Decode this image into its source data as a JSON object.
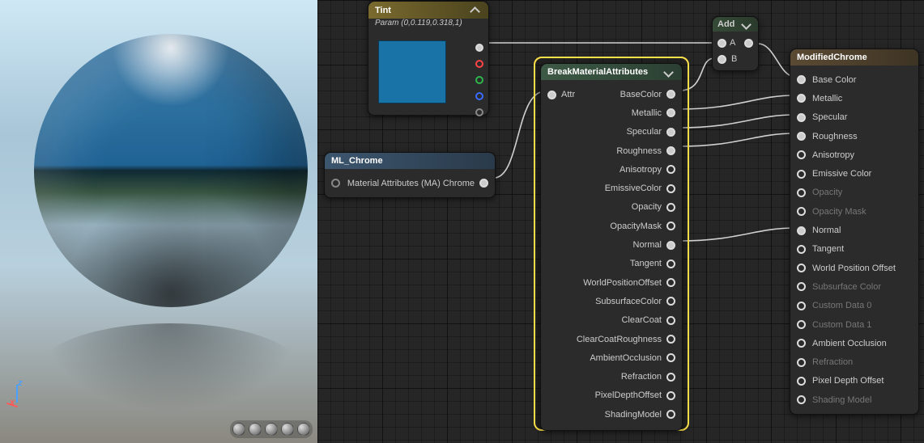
{
  "preview": {
    "axis_z": "z",
    "axis_x": "x"
  },
  "tint": {
    "title": "Tint",
    "subtitle": "Param (0,0.119,0.318,1)",
    "swatch_color": "#1a73a6"
  },
  "ml_chrome": {
    "title": "ML_Chrome",
    "output": "Material Attributes (MA) Chrome"
  },
  "break": {
    "title": "BreakMaterialAttributes",
    "input": "Attr",
    "outputs": [
      "BaseColor",
      "Metallic",
      "Specular",
      "Roughness",
      "Anisotropy",
      "EmissiveColor",
      "Opacity",
      "OpacityMask",
      "Normal",
      "Tangent",
      "WorldPositionOffset",
      "SubsurfaceColor",
      "ClearCoat",
      "ClearCoatRoughness",
      "AmbientOcclusion",
      "Refraction",
      "PixelDepthOffset",
      "ShadingModel"
    ]
  },
  "add": {
    "title": "Add",
    "in_a": "A",
    "in_b": "B"
  },
  "modchrome": {
    "title": "ModifiedChrome",
    "inputs": [
      {
        "label": "Base Color",
        "on": true
      },
      {
        "label": "Metallic",
        "on": true
      },
      {
        "label": "Specular",
        "on": true
      },
      {
        "label": "Roughness",
        "on": true
      },
      {
        "label": "Anisotropy",
        "on": true
      },
      {
        "label": "Emissive Color",
        "on": true
      },
      {
        "label": "Opacity",
        "on": false
      },
      {
        "label": "Opacity Mask",
        "on": false
      },
      {
        "label": "Normal",
        "on": true
      },
      {
        "label": "Tangent",
        "on": true
      },
      {
        "label": "World Position Offset",
        "on": true
      },
      {
        "label": "Subsurface Color",
        "on": false
      },
      {
        "label": "Custom Data 0",
        "on": false
      },
      {
        "label": "Custom Data 1",
        "on": false
      },
      {
        "label": "Ambient Occlusion",
        "on": true
      },
      {
        "label": "Refraction",
        "on": false
      },
      {
        "label": "Pixel Depth Offset",
        "on": true
      },
      {
        "label": "Shading Model",
        "on": false
      }
    ]
  }
}
